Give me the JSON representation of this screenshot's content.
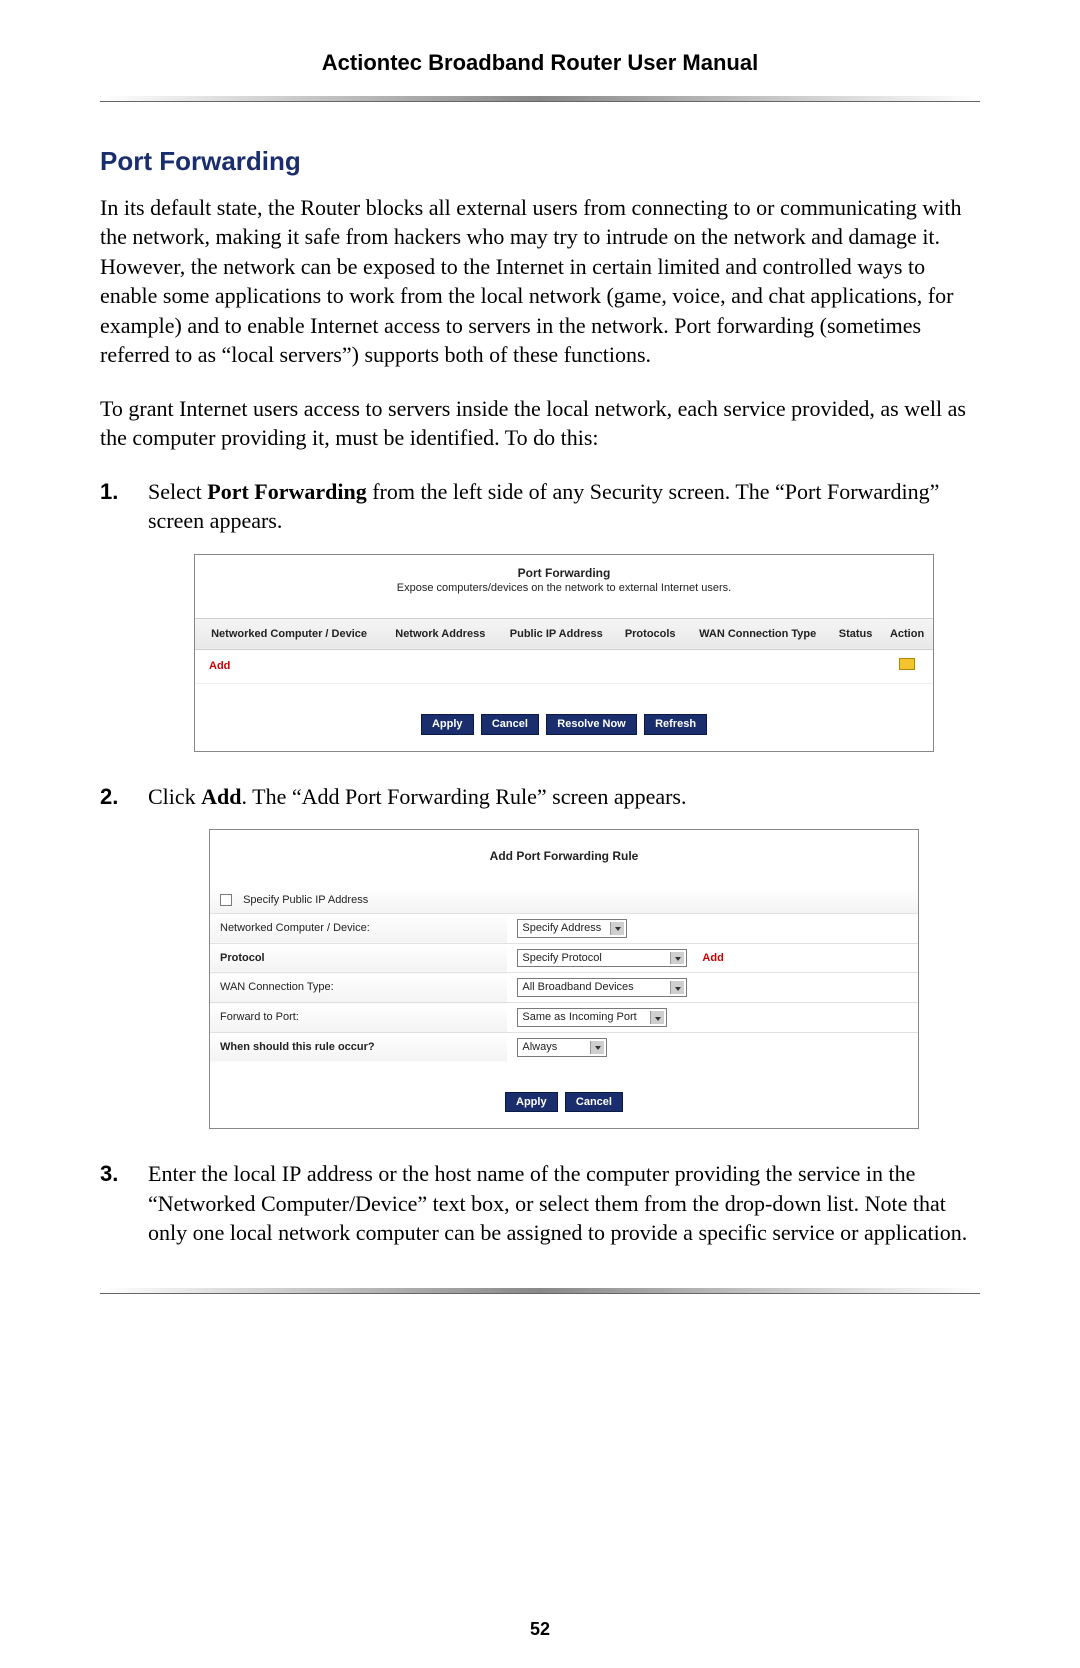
{
  "doc_header": "Actiontec Broadband Router User Manual",
  "section_title": "Port Forwarding",
  "para1": "In its default state, the Router blocks all external users from connecting to or communicating with the network, making it safe from hackers who may try to intrude on the network and damage it. However, the network can be exposed to the Internet in certain limited and controlled ways to enable some applications to work from the local network (game, voice, and chat applications, for example) and to enable Internet access to servers in the network. Port forwarding (sometimes referred to as “local servers”) supports both of these functions.",
  "para2": "To grant Internet users access to servers inside the local network, each service provided, as well as the computer providing it, must be identified. To do this:",
  "step1_pre": "Select ",
  "step1_bold": "Port Forwarding",
  "step1_post": " from the left side of any Security screen. The “Port Forwarding” screen appears.",
  "step2_pre": "Click ",
  "step2_bold": "Add",
  "step2_post": ". The “Add Port Forwarding Rule” screen appears.",
  "step3_pre": "Enter the local ",
  "step3_ip": "IP",
  "step3_post": " address or the host name of the computer providing the service in the “Networked Computer/Device” text box, or select them from the drop-down list. Note that only one local network computer can be assigned to provide a specific service or application.",
  "panel1": {
    "title": "Port Forwarding",
    "subtitle": "Expose computers/devices on the network to external Internet users.",
    "headers": [
      "Networked Computer / Device",
      "Network Address",
      "Public IP Address",
      "Protocols",
      "WAN Connection Type",
      "Status",
      "Action"
    ],
    "add_label": "Add",
    "buttons": [
      "Apply",
      "Cancel",
      "Resolve Now",
      "Refresh"
    ]
  },
  "panel2": {
    "title": "Add Port Forwarding Rule",
    "rows": {
      "spec_pub": "Specify Public IP Address",
      "net_dev": "Networked Computer / Device:",
      "net_dev_sel": "Specify Address",
      "protocol": "Protocol",
      "protocol_sel": "Specify Protocol",
      "protocol_add": "Add",
      "wan": "WAN Connection Type:",
      "wan_sel": "All Broadband Devices",
      "fwd": "Forward to Port:",
      "fwd_sel": "Same as Incoming Port",
      "when": "When should this rule occur?",
      "when_sel": "Always"
    },
    "buttons": [
      "Apply",
      "Cancel"
    ]
  },
  "page_number": "52"
}
